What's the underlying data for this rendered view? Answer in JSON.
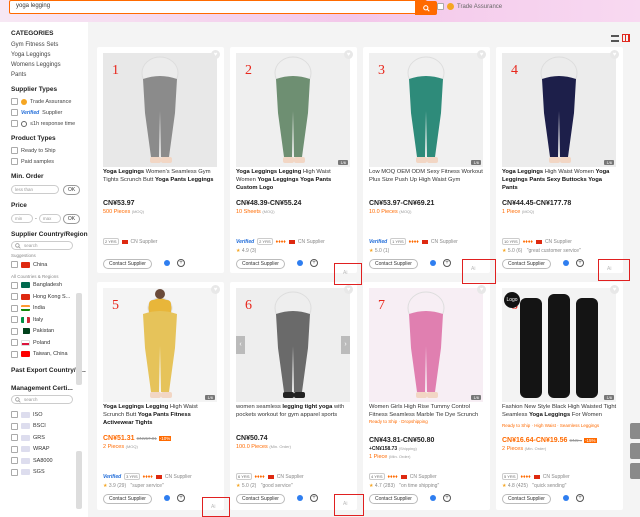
{
  "header": {
    "search_value": "yoga legging",
    "trade_assurance": "Trade Assurance"
  },
  "sidebar": {
    "categories_title": "CATEGORIES",
    "categories": [
      "Gym Fitness Sets",
      "Yoga Leggings",
      "Womens Leggings",
      "Pants"
    ],
    "supplier_types_title": "Supplier Types",
    "supplier_types": [
      "Trade Assurance",
      "Supplier",
      "≤1h response time"
    ],
    "verified": "Verified",
    "product_types_title": "Product Types",
    "product_types": [
      "Ready to Ship",
      "Paid samples"
    ],
    "min_order_title": "Min. Order",
    "less_than": "less than",
    "ok": "OK",
    "price_title": "Price",
    "min": "min",
    "dash": "-",
    "max": "max",
    "region_title": "Supplier Country/Region",
    "search_placeholder": "search",
    "suggestions": "Suggestions",
    "suggested_country": "China",
    "all_label": "All Countries & Regions",
    "countries": [
      "Bangladesh",
      "Hong Kong S...",
      "India",
      "Italy",
      "Pakistan",
      "Poland",
      "Taiwan, China"
    ],
    "past_export_title": "Past Export Country/R...",
    "mgmt_title": "Management Certi...",
    "certs": [
      "ISO",
      "BSCI",
      "GRS",
      "WRAP",
      "SA8000",
      "SGS"
    ]
  },
  "products": [
    {
      "num": "1",
      "title_pre": "",
      "title_bold": "Yoga Leggings",
      "title_rest": " Women's Seamless Gym Tights Scrunch Butt ",
      "title_bold2": "Yoga Pants Leggings",
      "price": "CN¥53.97",
      "moq": "500 Pieces",
      "moq_unit": "(MOQ)",
      "supplier": "CN Supplier",
      "years": "2 YRS",
      "verified": "",
      "rating": "",
      "contact": "Contact Supplier",
      "badge": ""
    },
    {
      "num": "2",
      "title_pre": "",
      "title_bold": "Yoga Leggings Legging",
      "title_rest": " High Waist Women ",
      "title_bold2": "Yoga Leggings Yoga Pants Custom Logo",
      "price": "CN¥48.39-CN¥55.24",
      "moq": "10 Sheets",
      "moq_unit": "(MOQ)",
      "supplier": "CN Supplier",
      "years": "2 YRS",
      "verified": "Verified",
      "rating": "4.9 (3)",
      "contact": "Contact Supplier",
      "badge": "1/6"
    },
    {
      "num": "3",
      "title_pre": "",
      "title_bold": "",
      "title_rest": "Low MOQ OEM ODM Sexy Fitness Workout Plus Size Push Up High Waist Gym",
      "title_bold2": "",
      "price": "CN¥53.97-CN¥69.21",
      "moq": "10.0 Pieces",
      "moq_unit": "(MOQ)",
      "supplier": "CN Supplier",
      "years": "1 YRS",
      "verified": "Verified",
      "rating": "5.0 (1)",
      "contact": "Contact Supplier",
      "badge": "1/6"
    },
    {
      "num": "4",
      "title_pre": "",
      "title_bold": "Yoga Leggings",
      "title_rest": " High Waist Women ",
      "title_bold2": "Yoga Leggings Pants Sexy Buttocks Yoga Pants",
      "price": "CN¥44.45-CN¥177.78",
      "moq": "1 Piece",
      "moq_unit": "(MOQ)",
      "supplier": "CN Supplier",
      "years": "10 YRS",
      "verified": "",
      "rating": "5.0 (6)",
      "review_quote": "\"great customer service\"",
      "contact": "Contact Supplier",
      "badge": "1/6"
    },
    {
      "num": "5",
      "title_pre": "",
      "title_bold": "Yoga Leggings Legging",
      "title_rest": " High Waist Scrunch Butt ",
      "title_bold2": "Yoga Pants Fitness Activewear Tights",
      "price": "CN¥51.31",
      "price_old": "CN¥57.01",
      "discount": "-10%",
      "moq": "2 Pieces",
      "moq_unit": "(MOQ)",
      "supplier": "CN Supplier",
      "years": "3 YRS",
      "verified": "Verified",
      "rating": "3.9 (29)",
      "review_quote": "\"super service\"",
      "contact": "Contact Supplier",
      "badge": "1/6"
    },
    {
      "num": "6",
      "title_pre": "",
      "title_bold": "",
      "title_rest": "women seamless ",
      "title_bold2": "legging tight yoga",
      "title_tail": " with pockets workout for gym apparel sports",
      "price": "CN¥50.74",
      "moq": "100.0 Pieces",
      "moq_unit": "(Min. Order)",
      "supplier": "CN Supplier",
      "years": "6 YRS",
      "verified": "",
      "rating": "5.0 (2)",
      "review_quote": "\"good service\"",
      "contact": "Contact Supplier",
      "badge": ""
    },
    {
      "num": "7",
      "title_pre": "",
      "title_bold": "",
      "title_rest": "Women Girls High Rise Tummy Control Fitness Seamless Marble Tie Dye Scrunch",
      "title_bold2": "",
      "ready": "Ready to Ship · Dropshipping",
      "price": "CN¥43.81-CN¥50.80",
      "shipping": "+CN¥158.73",
      "shipping_unit": "(Shipping)",
      "moq": "1 Piece",
      "moq_unit": "(Min. Order)",
      "supplier": "CN Supplier",
      "years": "4 YRS",
      "verified": "",
      "rating": "4.7 (283)",
      "review_quote": "\"on time shipping\"",
      "contact": "Contact Supplier",
      "badge": "1/6"
    },
    {
      "num": "8",
      "title_pre": "",
      "title_bold": "",
      "title_rest": "Fashion New Style Black High Waisted Tight Seamless ",
      "title_bold2": "Yoga Leggings",
      "title_tail": " For Women",
      "ready": "Ready to Ship · High Waist · Seamless Leggings",
      "price": "CN¥16.64-CN¥19.56",
      "price_old": "CN¥...",
      "discount": "-15%",
      "moq": "2 Pieces",
      "moq_unit": "(Min. Order)",
      "supplier": "CN Supplier",
      "years": "5 YRS",
      "verified": "",
      "rating": "4.8 (425)",
      "review_quote": "\"quick sending\"",
      "contact": "Contact Supplier",
      "badge": "1/6",
      "logo": "Logo"
    }
  ]
}
